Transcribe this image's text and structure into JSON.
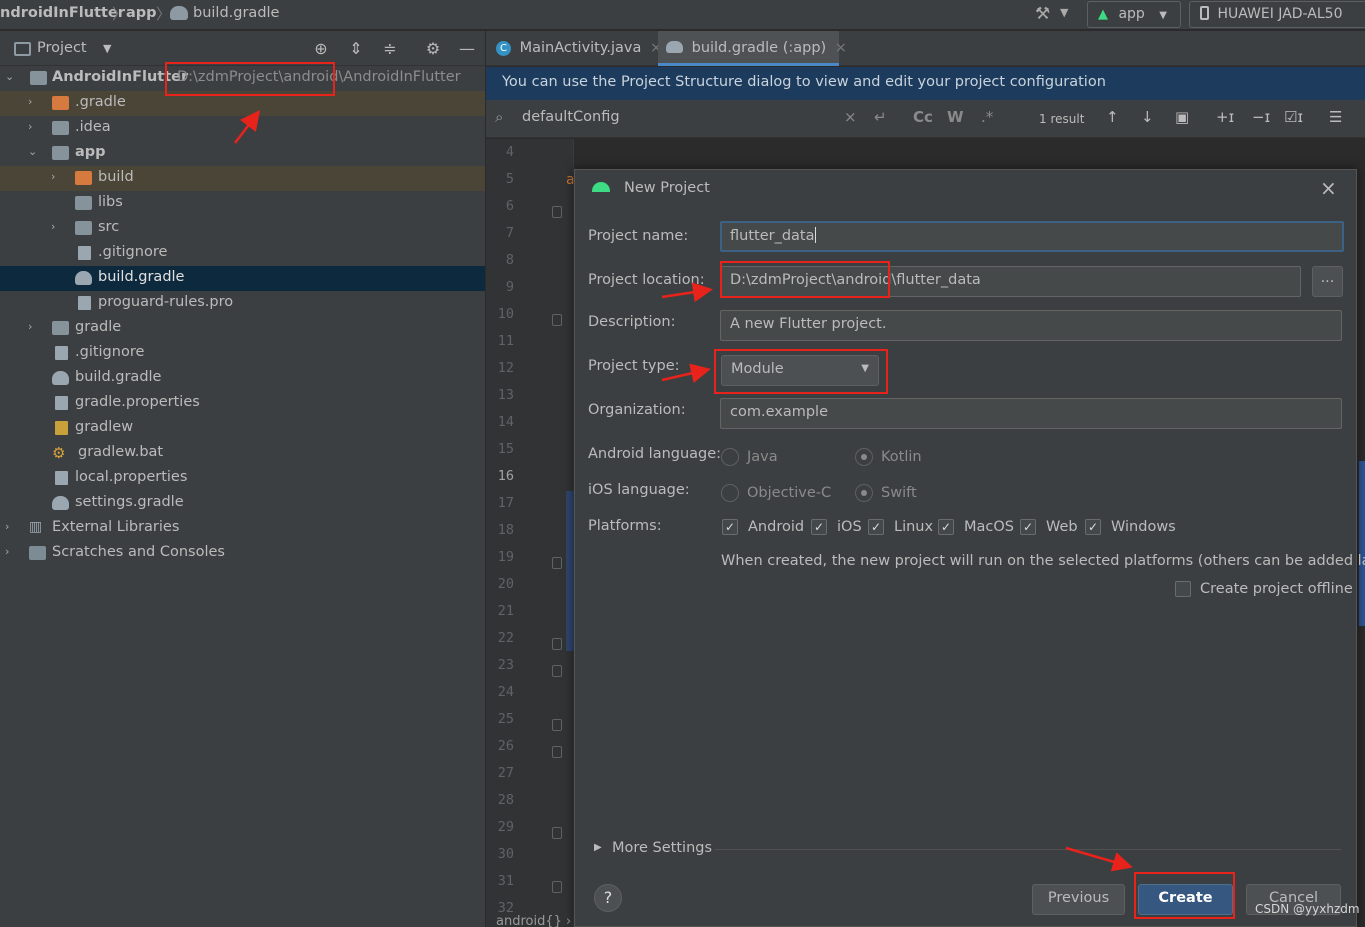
{
  "navbar": {
    "crumbs": [
      "ndroidInFlutter",
      "app",
      "build.gradle"
    ],
    "run_config": "app",
    "device": "HUAWEI JAD-AL50"
  },
  "project_panel": {
    "title": "Project",
    "tree": [
      {
        "label": "AndroidInFlutter",
        "path": "D:\\zdmProject\\android\\AndroidInFlutter"
      },
      {
        "label": ".gradle"
      },
      {
        "label": ".idea"
      },
      {
        "label": "app"
      },
      {
        "label": "build"
      },
      {
        "label": "libs"
      },
      {
        "label": "src"
      },
      {
        "label": ".gitignore"
      },
      {
        "label": "build.gradle"
      },
      {
        "label": "proguard-rules.pro"
      },
      {
        "label": "gradle"
      },
      {
        "label": ".gitignore"
      },
      {
        "label": "build.gradle"
      },
      {
        "label": "gradle.properties"
      },
      {
        "label": "gradlew"
      },
      {
        "label": "gradlew.bat"
      },
      {
        "label": "local.properties"
      },
      {
        "label": "settings.gradle"
      },
      {
        "label": "External Libraries"
      },
      {
        "label": "Scratches and Consoles"
      }
    ]
  },
  "editor": {
    "tabs": [
      {
        "label": "MainActivity.java"
      },
      {
        "label": "build.gradle (:app)"
      }
    ],
    "banner": "You can use the Project Structure dialog to view and edit your project configuration",
    "search": {
      "value": "defaultConfig",
      "case_label": "Cc",
      "word_label": "W",
      "regex_label": ".*",
      "result": "1 result"
    },
    "line_numbers": [
      "4",
      "5",
      "6",
      "7",
      "8",
      "9",
      "10",
      "11",
      "12",
      "13",
      "14",
      "15",
      "16",
      "17",
      "18",
      "19",
      "20",
      "21",
      "22",
      "23",
      "24",
      "25",
      "26",
      "27",
      "28",
      "29",
      "30",
      "31",
      "32"
    ],
    "code_fragment": "a",
    "breadcrumb": "android{}  ›  defaultConfig{}"
  },
  "dialog": {
    "title": "New Project",
    "fields": {
      "project_name": {
        "label": "Project name:",
        "value": "flutter_data"
      },
      "project_location": {
        "label": "Project location:",
        "value": "D:\\zdmProject\\android\\flutter_data",
        "browse": "..."
      },
      "description": {
        "label": "Description:",
        "value": "A new Flutter project."
      },
      "project_type": {
        "label": "Project type:",
        "value": "Module"
      },
      "organization": {
        "label": "Organization:",
        "value": "com.example"
      }
    },
    "android_language": {
      "label": "Android language:",
      "options": [
        "Java",
        "Kotlin"
      ],
      "selected": "Kotlin"
    },
    "ios_language": {
      "label": "iOS language:",
      "options": [
        "Objective-C",
        "Swift"
      ],
      "selected": "Swift"
    },
    "platforms": {
      "label": "Platforms:",
      "items": [
        "Android",
        "iOS",
        "Linux",
        "MacOS",
        "Web",
        "Windows"
      ],
      "note": "When created, the new project will run on the selected platforms (others can be added later)."
    },
    "offline_label": "Create project offline",
    "more_settings": "More Settings",
    "buttons": {
      "help": "?",
      "previous": "Previous",
      "create": "Create",
      "cancel": "Cancel"
    }
  },
  "watermark": "CSDN @yyxhzdm",
  "colors": {
    "accent": "#4a88c7",
    "annotation": "#e8231b",
    "primary_button": "#365880",
    "banner": "#1d3b5c"
  }
}
